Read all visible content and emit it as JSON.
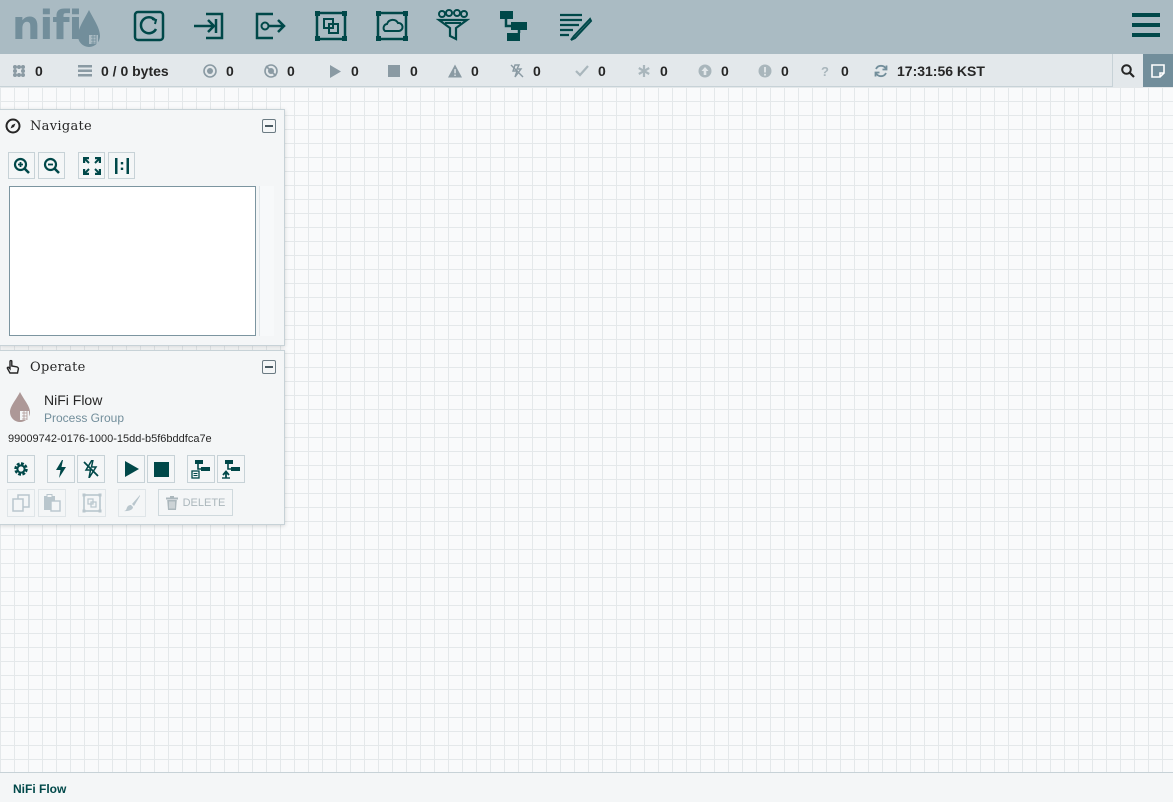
{
  "header": {
    "logo_text": "nifi",
    "toolbar": [
      {
        "name": "processor",
        "icon": "processor-icon"
      },
      {
        "name": "input-port",
        "icon": "input-port-icon"
      },
      {
        "name": "output-port",
        "icon": "output-port-icon"
      },
      {
        "name": "process-group",
        "icon": "process-group-icon"
      },
      {
        "name": "remote-process-group",
        "icon": "remote-process-group-icon"
      },
      {
        "name": "funnel",
        "icon": "funnel-icon"
      },
      {
        "name": "template",
        "icon": "template-icon"
      },
      {
        "name": "label",
        "icon": "label-icon"
      }
    ],
    "menu_icon": "hamburger-icon"
  },
  "status": {
    "active_threads": "0",
    "queued": "0 / 0 bytes",
    "transmitting": "0",
    "not_transmitting": "0",
    "running": "0",
    "stopped": "0",
    "invalid": "0",
    "disabled": "0",
    "up_to_date": "0",
    "locally_modified": "0",
    "stale": "0",
    "sync_failure": "0",
    "unknown": "0",
    "refresh_time": "17:31:56 KST"
  },
  "navigate": {
    "title": "Navigate"
  },
  "operate": {
    "title": "Operate",
    "component_name": "NiFi Flow",
    "component_type": "Process Group",
    "component_id": "99009742-0176-1000-15dd-b5f6bddfca7e",
    "delete_label": "DELETE"
  },
  "breadcrumb": {
    "current": "NiFi Flow"
  },
  "colors": {
    "header": "#aabbc3",
    "accent": "#004849",
    "status_bar": "#e3e8eb"
  }
}
